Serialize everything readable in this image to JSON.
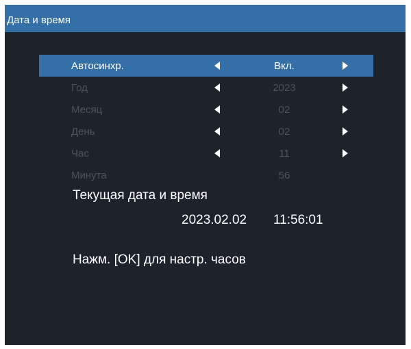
{
  "window": {
    "title": "Дата и время"
  },
  "menu": {
    "rows": [
      {
        "label": "Автосинхр.",
        "value": "Вкл.",
        "selected": true,
        "enabled": true,
        "arrows": true
      },
      {
        "label": "Год",
        "value": "2023",
        "selected": false,
        "enabled": false,
        "arrows": true
      },
      {
        "label": "Месяц",
        "value": "02",
        "selected": false,
        "enabled": false,
        "arrows": true
      },
      {
        "label": "День",
        "value": "02",
        "selected": false,
        "enabled": false,
        "arrows": true
      },
      {
        "label": "Час",
        "value": "11",
        "selected": false,
        "enabled": false,
        "arrows": true
      },
      {
        "label": "Минута",
        "value": "56",
        "selected": false,
        "enabled": false,
        "arrows": false
      }
    ]
  },
  "current": {
    "label": "Текущая дата и время",
    "date": "2023.02.02",
    "time": "11:56:01"
  },
  "hint": "Нажм. [OK] для настр. часов",
  "icons": {
    "left": "arrow-left-icon",
    "right": "arrow-right-icon"
  },
  "colors": {
    "background": "#1c232b",
    "accent": "#3470a7",
    "text": "#ffffff",
    "disabled_text": "#4b525a"
  }
}
